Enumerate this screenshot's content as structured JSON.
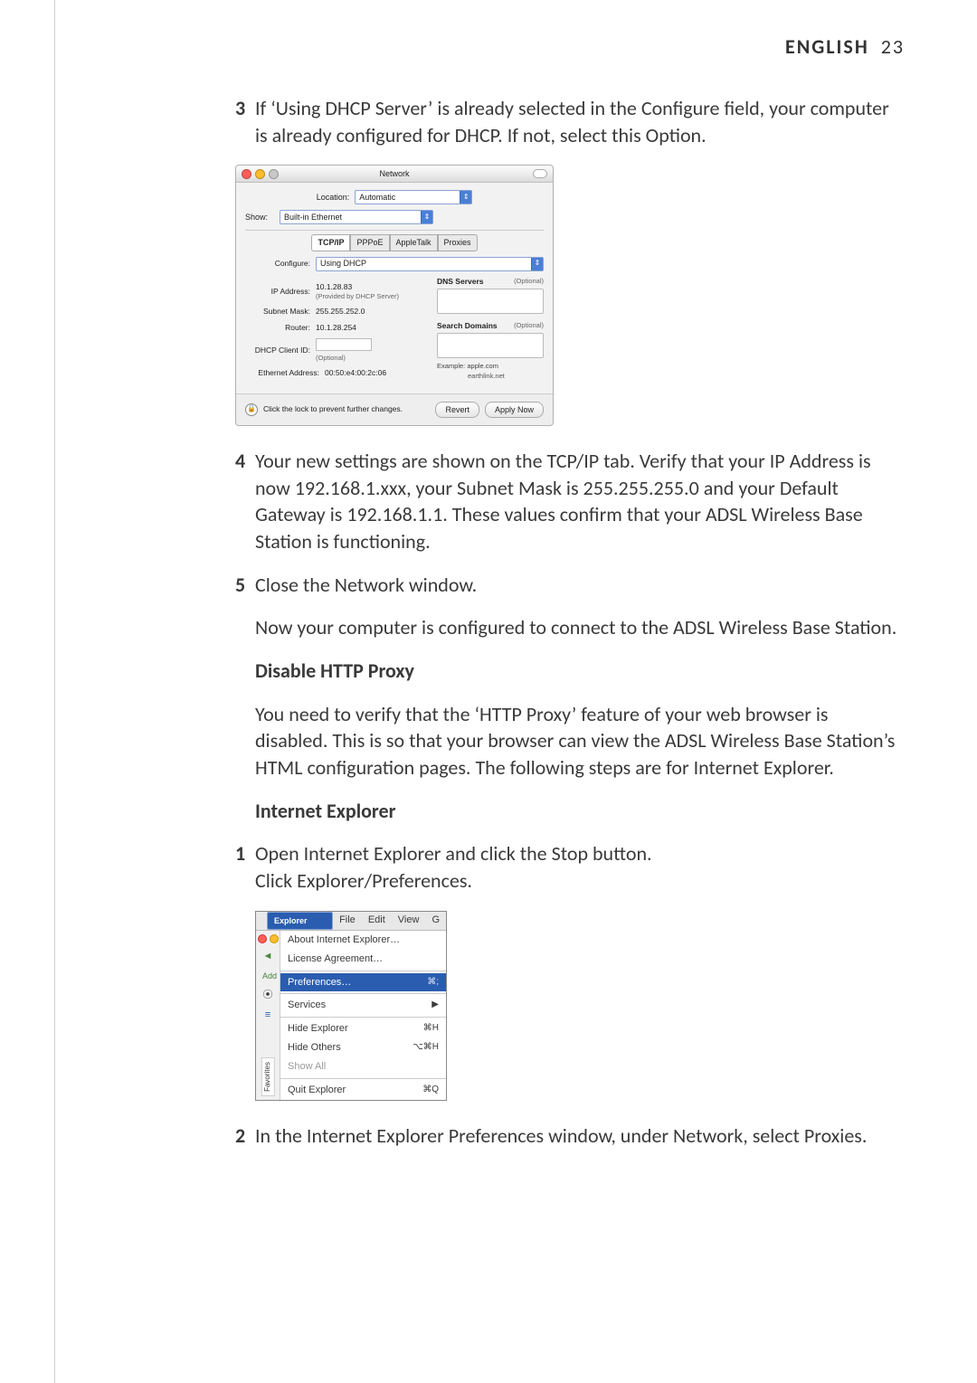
{
  "header": {
    "language": "ENGLISH",
    "page_number": "23"
  },
  "steps": {
    "s3": {
      "num": "3",
      "text": "If ‘Using DHCP Server’ is already selected in the Configure field, your computer is already configured for DHCP. If not, select this Option."
    },
    "s4": {
      "num": "4",
      "text": "Your new settings are shown on the TCP/IP tab. Verify that your IP Address is now 192.168.1.xxx, your Subnet Mask is 255.255.255.0 and your Default Gateway is 192.168.1.1. These values confirm that your ADSL Wireless Base Station is functioning."
    },
    "s5": {
      "num": "5",
      "text": "Close the Network window."
    },
    "after5": "Now your computer is configured to connect to the ADSL Wireless Base Station.",
    "proxy_heading": "Disable HTTP Proxy",
    "proxy_text": "You need to verify that the ‘HTTP Proxy’ feature of your web browser is disabled. This is so that your browser can view the ADSL Wireless Base Station’s HTML configuration pages. The following steps are for Internet Explorer.",
    "ie_heading": "Internet Explorer",
    "ie1": {
      "num": "1",
      "line1": "Open Internet Explorer and click the Stop button.",
      "line2": "Click Explorer/Preferences."
    },
    "ie2": {
      "num": "2",
      "text": "In the Internet Explorer Preferences window, under Network, select Proxies."
    }
  },
  "macwin": {
    "title": "Network",
    "location_label": "Location:",
    "location_value": "Automatic",
    "show_label": "Show:",
    "show_value": "Built-in Ethernet",
    "tabs": {
      "tcpip": "TCP/IP",
      "pppoe": "PPPoE",
      "appletalk": "AppleTalk",
      "proxies": "Proxies"
    },
    "configure_label": "Configure:",
    "configure_value": "Using DHCP",
    "ip_label": "IP Address:",
    "ip_value": "10.1.28.83",
    "ip_sub": "(Provided by DHCP Server)",
    "subnet_label": "Subnet Mask:",
    "subnet_value": "255.255.252.0",
    "router_label": "Router:",
    "router_value": "10.1.28.254",
    "dhcpid_label": "DHCP Client ID:",
    "dhcpid_sub": "(Optional)",
    "eth_label": "Ethernet Address:",
    "eth_value": "00:50:e4:00:2c:06",
    "dns_label": "DNS Servers",
    "dns_opt": "(Optional)",
    "search_label": "Search Domains",
    "search_opt": "(Optional)",
    "example_label": "Example:",
    "example_val1": "apple.com",
    "example_val2": "earthlink.net",
    "lock_text": "Click the lock to prevent further changes.",
    "revert": "Revert",
    "apply": "Apply Now"
  },
  "iemenu": {
    "menubar": {
      "explorer": "Explorer",
      "file": "File",
      "edit": "Edit",
      "view": "View",
      "g": "G"
    },
    "about": "About Internet Explorer…",
    "license": "License Agreement…",
    "preferences": "Preferences…",
    "pref_key": "⌘;",
    "services": "Services",
    "hide_explorer": "Hide Explorer",
    "hide_explorer_key": "⌘H",
    "hide_others": "Hide Others",
    "hide_others_key": "⌥⌘H",
    "show_all": "Show All",
    "quit": "Quit Explorer",
    "quit_key": "⌘Q",
    "side_add": "Add",
    "side_fav": "Favorites"
  }
}
